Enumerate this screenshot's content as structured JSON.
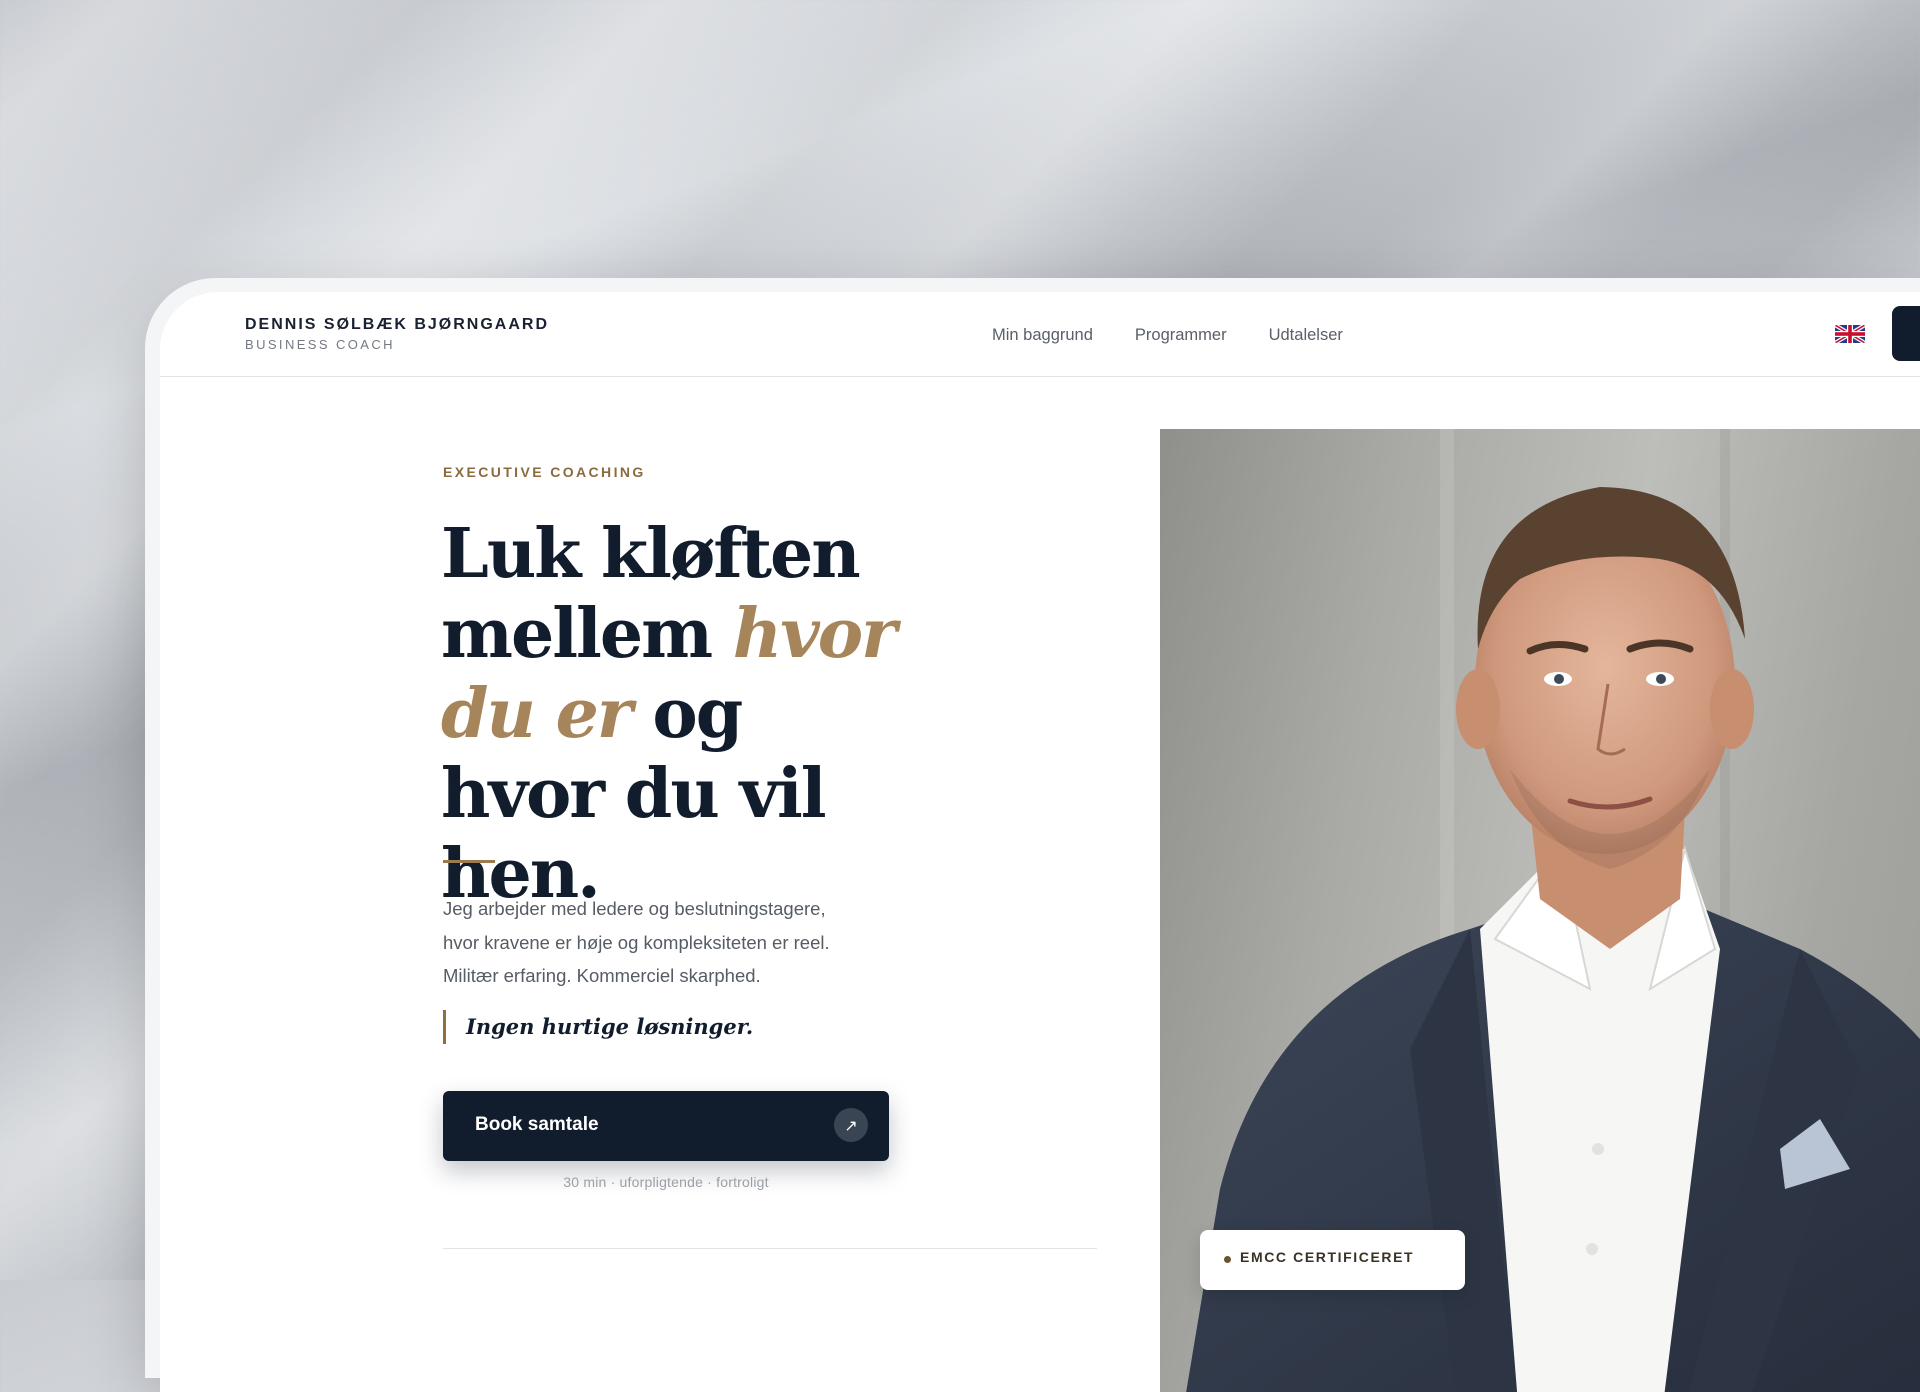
{
  "header": {
    "brand_name": "DENNIS SØLBÆK BJØRNGAARD",
    "brand_role": "BUSINESS COACH",
    "nav": [
      "Min baggrund",
      "Programmer",
      "Udtalelser"
    ],
    "language_flag_icon": "uk-flag-icon"
  },
  "hero": {
    "eyebrow": "EXECUTIVE COACHING",
    "headline": {
      "line1": "Luk kløften",
      "line2_pre": "mellem ",
      "line2_accent": "hvor",
      "line3_accent": "du er",
      "line3_post": " og",
      "line4": "hvor du vil hen."
    },
    "lede": [
      "Jeg arbejder med ledere og beslutningstagere,",
      "hvor kravene er høje og kompleksiteten er reel.",
      "Militær erfaring. Kommerciel skarphed."
    ],
    "quote": "Ingen hurtige løsninger.",
    "cta_label": "Book samtale",
    "cta_icon": "arrow-up-right-icon",
    "cta_note": "30 min · uforpligtende · fortroligt"
  },
  "portrait": {
    "badge": "EMCC CERTIFICERET"
  },
  "colors": {
    "navy": "#111c2c",
    "gold": "#a6855a",
    "text_muted": "#565c64"
  }
}
